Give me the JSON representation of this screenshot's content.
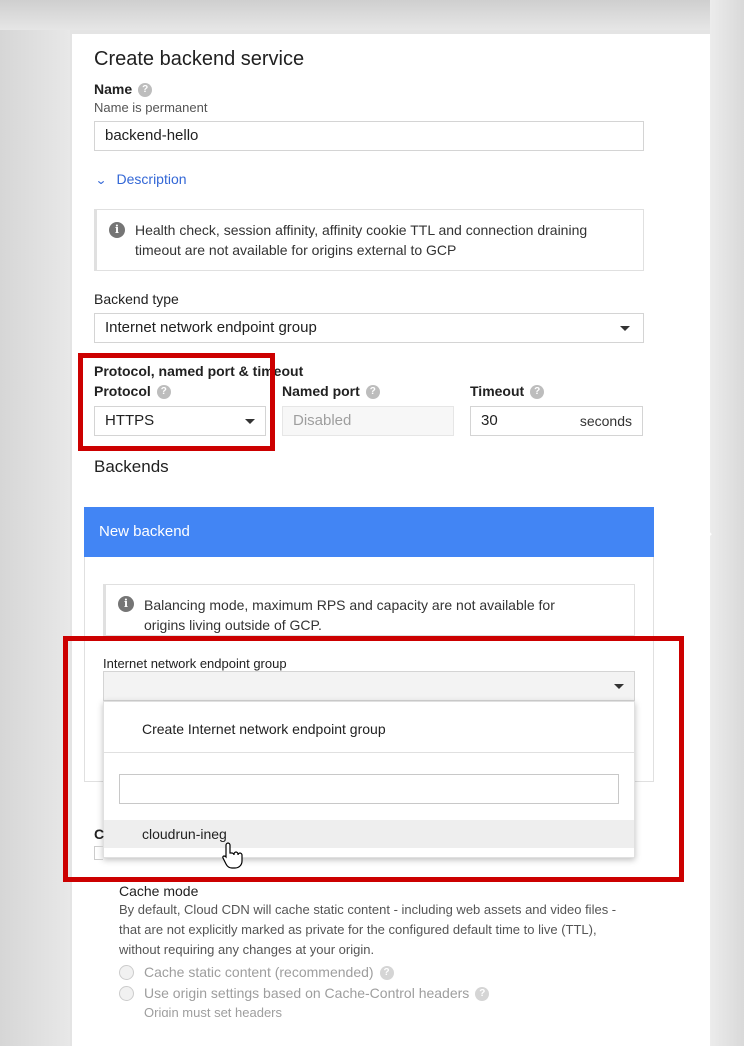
{
  "page": {
    "title": "Create backend service"
  },
  "name_field": {
    "label": "Name",
    "hint": "Name is permanent",
    "value": "backend-hello"
  },
  "description_toggle": {
    "label": "Description"
  },
  "info_external": {
    "text_line1": "Health check, session affinity, affinity cookie TTL and connection draining",
    "text_line2": "timeout are not available for origins external to GCP"
  },
  "backend_type": {
    "label": "Backend type",
    "value": "Internet network endpoint group"
  },
  "protocol_section": {
    "heading": "Protocol, named port & timeout",
    "protocol_label": "Protocol",
    "protocol_value": "HTTPS",
    "named_port_label": "Named port",
    "named_port_placeholder": "Disabled",
    "timeout_label": "Timeout",
    "timeout_value": "30",
    "timeout_unit": "seconds"
  },
  "backends": {
    "heading": "Backends",
    "new_backend_label": "New backend",
    "info_line1": "Balancing mode, maximum RPS and capacity are not available for",
    "info_line2": "origins living outside of GCP.",
    "neg_label": "Internet network endpoint group",
    "dropdown": {
      "create_option": "Create Internet network endpoint group",
      "search_value": "",
      "options": [
        "cloudrun-ineg"
      ]
    }
  },
  "cdn": {
    "partial_label": "C",
    "cache_mode_label": "Cache mode",
    "cache_desc_line1": "By default, Cloud CDN will cache static content - including web assets and video files -",
    "cache_desc_line2": "that are not explicitly marked as private for the configured default time to live (TTL),",
    "cache_desc_line3": "without requiring any changes at your origin.",
    "option1": "Cache static content (recommended)",
    "option2": "Use origin settings based on Cache-Control headers",
    "option2_note": "Origin must set headers"
  },
  "colors": {
    "accent": "#4285f4",
    "highlight": "#cc0000",
    "link": "#3367d6"
  }
}
